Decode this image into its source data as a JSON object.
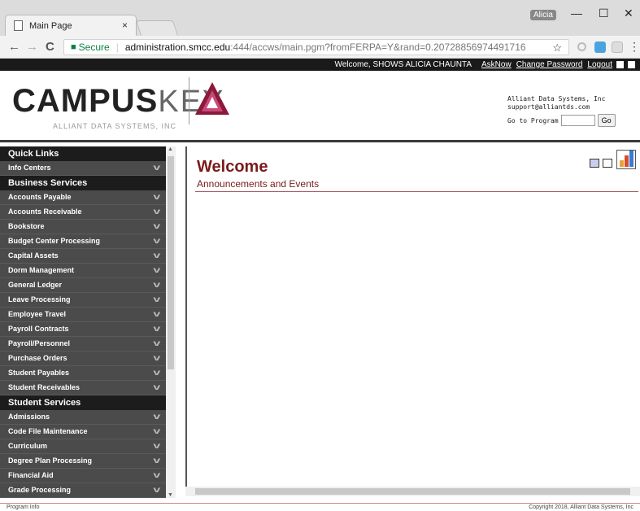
{
  "browser": {
    "tab_title": "Main Page",
    "tab_close": "×",
    "profile": "Alicia",
    "win_min": "—",
    "win_max": "☐",
    "win_close": "✕",
    "back": "←",
    "forward": "→",
    "reload": "C",
    "secure_label": "Secure",
    "url_host": "administration.smcc.edu",
    "url_rest": ":444/accws/main.pgm?fromFERPA=Y&rand=0.20728856974491716",
    "star": "☆",
    "menu": "⋮"
  },
  "topstrip": {
    "welcome": "Welcome, SHOWS ALICIA CHAUNTA",
    "asknow": "AskNow",
    "change_password": "Change Password",
    "logout": "Logout"
  },
  "header": {
    "logo_campus": "CAMPUS",
    "logo_key": "KEY",
    "logo_sub": "ALLIANT DATA SYSTEMS, INC",
    "company_name": "Alliant Data Systems, Inc",
    "company_email": "support@alliantds.com",
    "goto_label": "Go to Program",
    "goto_value": "",
    "go_button": "Go"
  },
  "sidebar": {
    "sections": [
      {
        "header": "Quick Links",
        "items": [
          "Info Centers"
        ]
      },
      {
        "header": "Business Services",
        "items": [
          "Accounts Payable",
          "Accounts Receivable",
          "Bookstore",
          "Budget Center Processing",
          "Capital Assets",
          "Dorm Management",
          "General Ledger",
          "Leave Processing",
          "Employee Travel",
          "Payroll Contracts",
          "Payroll/Personnel",
          "Purchase Orders",
          "Student Payables",
          "Student Receivables"
        ]
      },
      {
        "header": "Student Services",
        "items": [
          "Admissions",
          "Code File Maintenance",
          "Curriculum",
          "Degree Plan Processing",
          "Financial Aid",
          "Grade Processing"
        ]
      }
    ]
  },
  "main": {
    "title": "Welcome",
    "subtitle": "Announcements and Events"
  },
  "footer": {
    "left": "Program Info",
    "right": "Copyright 2018, Alliant Data Systems, Inc"
  },
  "colors": {
    "accent": "#7a1a1a",
    "sidebar_bg": "#4a4a4a",
    "section_bg": "#1c1c1c"
  }
}
